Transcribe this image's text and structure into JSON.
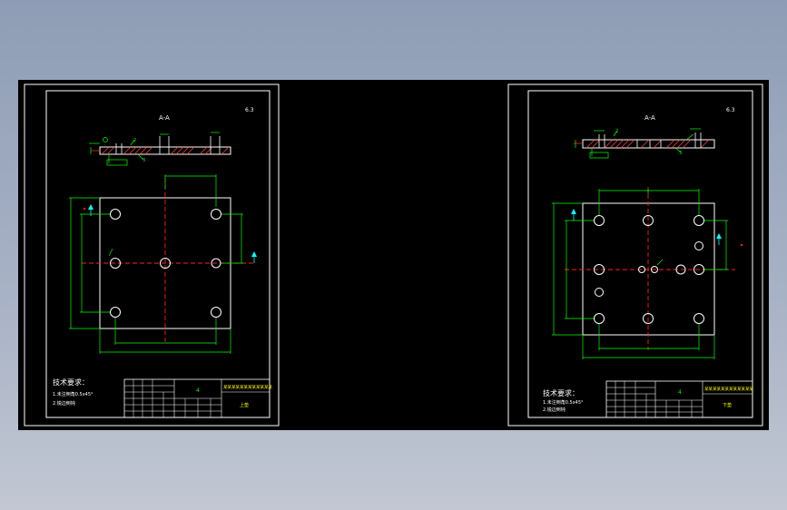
{
  "colors": {
    "background": "#000000",
    "frame": "#ffffff",
    "outline": "#ffffff",
    "dimension": "#00ff00",
    "centerline": "#ff2020",
    "hole": "#ffffff",
    "annotation": "#00ffff",
    "title_text": "#ffff00"
  },
  "left_sheet": {
    "section_label": "A-A",
    "roughness": "6.3",
    "part_refs": [
      "2",
      "3"
    ],
    "title_cell": "4",
    "block_title": "某某某某某某某某某某某某",
    "block_code": "上垫",
    "tech_heading": "技术要求：",
    "tech_notes": [
      "1.未注倒角0.5x45°",
      "2.锐边倒钝"
    ]
  },
  "right_sheet": {
    "section_label": "A-A",
    "roughness": "6.3",
    "part_refs": [
      "2",
      "3"
    ],
    "title_cell": "4",
    "block_title": "某某某某某某某某某某某某",
    "block_code": "下垫",
    "tech_heading": "技术要求：",
    "tech_notes": [
      "1.未注倒角0.5x45°",
      "2.锐边倒钝"
    ]
  }
}
